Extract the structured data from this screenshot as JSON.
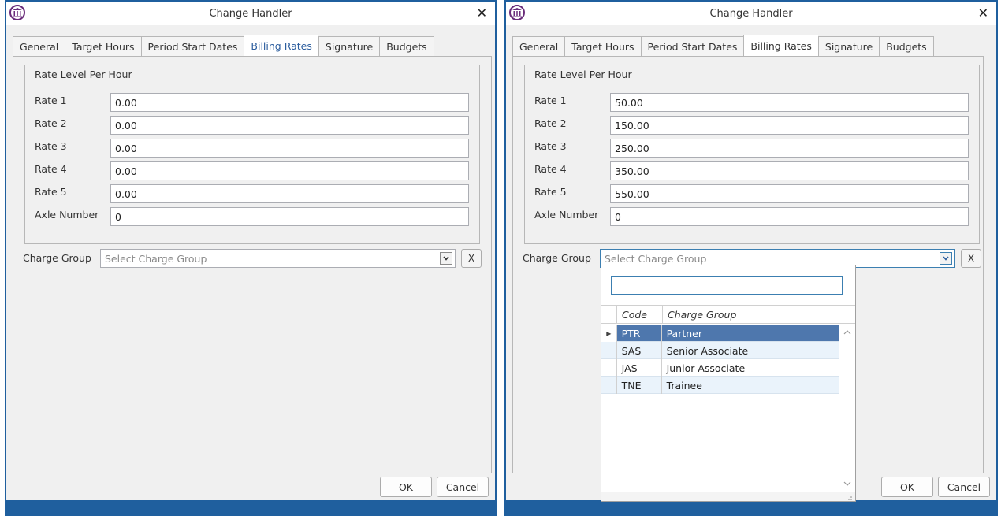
{
  "windows": [
    {
      "title": "Change Handler",
      "tabs": [
        "General",
        "Target Hours",
        "Period Start Dates",
        "Billing Rates",
        "Signature",
        "Budgets"
      ],
      "active_tab": "Billing Rates",
      "group_title": "Rate Level Per Hour",
      "fields": [
        {
          "label": "Rate 1",
          "value": "0.00"
        },
        {
          "label": "Rate 2",
          "value": "0.00"
        },
        {
          "label": "Rate 3",
          "value": "0.00"
        },
        {
          "label": "Rate 4",
          "value": "0.00"
        },
        {
          "label": "Rate 5",
          "value": "0.00"
        },
        {
          "label": "Axle Number",
          "value": "0"
        }
      ],
      "charge_group_label": "Charge Group",
      "charge_group_placeholder": "Select Charge Group",
      "clear_label": "X",
      "ok_label": "OK",
      "cancel_label": "Cancel"
    },
    {
      "title": "Change Handler",
      "tabs": [
        "General",
        "Target Hours",
        "Period Start Dates",
        "Billing Rates",
        "Signature",
        "Budgets"
      ],
      "active_tab": "Billing Rates",
      "group_title": "Rate Level Per Hour",
      "fields": [
        {
          "label": "Rate 1",
          "value": "50.00"
        },
        {
          "label": "Rate 2",
          "value": "150.00"
        },
        {
          "label": "Rate 3",
          "value": "250.00"
        },
        {
          "label": "Rate 4",
          "value": "350.00"
        },
        {
          "label": "Rate 5",
          "value": "550.00"
        },
        {
          "label": "Axle Number",
          "value": "0"
        }
      ],
      "charge_group_label": "Charge Group",
      "charge_group_placeholder": "Select Charge Group",
      "clear_label": "X",
      "ok_label": "OK",
      "cancel_label": "Cancel",
      "dropdown": {
        "search_value": "",
        "columns": [
          "Code",
          "Charge Group"
        ],
        "rows": [
          {
            "code": "PTR",
            "name": "Partner",
            "selected": true
          },
          {
            "code": "SAS",
            "name": "Senior Associate",
            "selected": false
          },
          {
            "code": "JAS",
            "name": "Junior Associate",
            "selected": false
          },
          {
            "code": "TNE",
            "name": "Trainee",
            "selected": false
          }
        ]
      }
    }
  ],
  "colors": {
    "title_bar_border": "#1f5f9e",
    "active_tab_text": "#2d5e9e",
    "selected_row": "#4e77ad",
    "alt_row": "#eaf3fb",
    "icon_purple": "#6a2c7a"
  }
}
